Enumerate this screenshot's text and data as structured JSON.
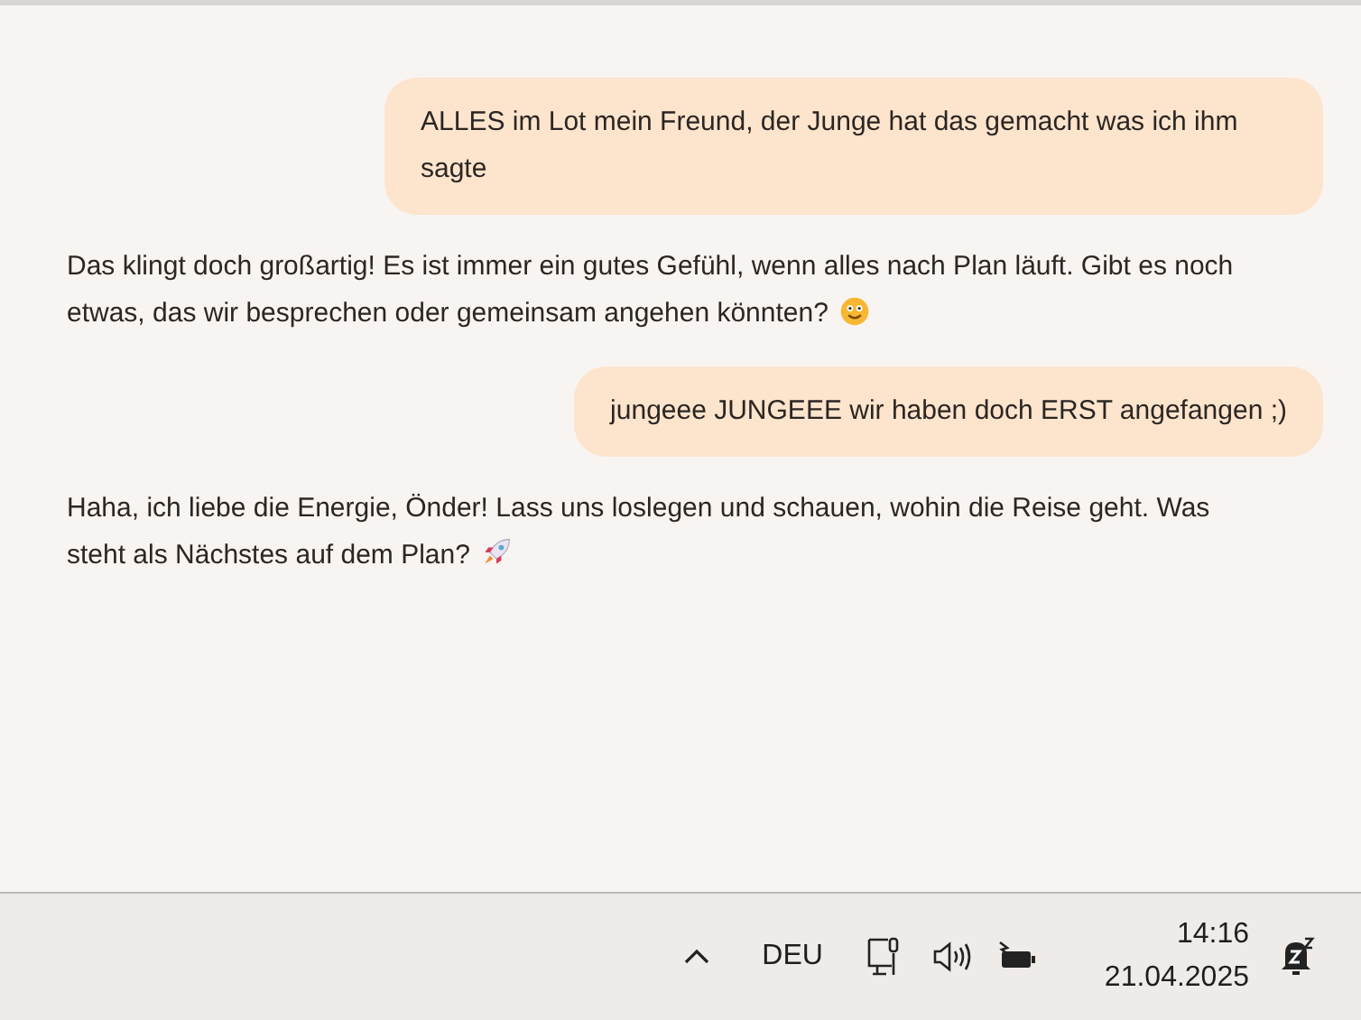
{
  "messages": [
    {
      "kind": "user",
      "text": "ALLES im Lot mein Freund, der Junge hat das gemacht was ich ihm sagte"
    },
    {
      "kind": "assistant",
      "text": "Das klingt doch großartig! Es ist immer ein gutes Gefühl, wenn alles nach Plan läuft. Gibt es noch etwas, das wir besprechen oder gemeinsam angehen könnten?",
      "emoji": {
        "kind": "smile"
      }
    },
    {
      "kind": "user",
      "text": "jungeee JUNGEEE wir haben doch ERST angefangen ;)"
    },
    {
      "kind": "assistant",
      "text": "Haha, ich liebe die Energie, Önder! Lass uns loslegen und schauen, wohin die Reise geht. Was steht als Nächstes auf dem Plan?",
      "emoji": {
        "kind": "rocket"
      }
    }
  ],
  "taskbar": {
    "language": "DEU",
    "time": "14:16",
    "date": "21.04.2025"
  }
}
